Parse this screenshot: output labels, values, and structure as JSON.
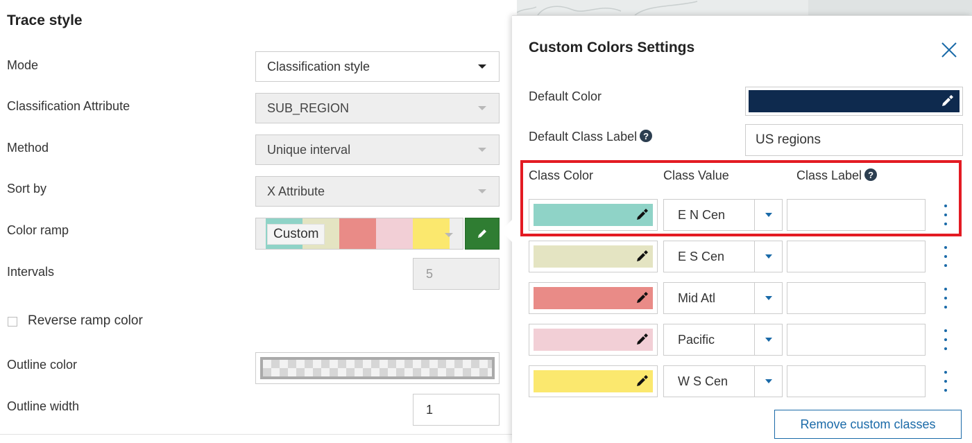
{
  "left_panel": {
    "title": "Trace style",
    "mode": {
      "label": "Mode",
      "value": "Classification style"
    },
    "classification_attribute": {
      "label": "Classification Attribute",
      "value": "SUB_REGION"
    },
    "method": {
      "label": "Method",
      "value": "Unique interval"
    },
    "sort_by": {
      "label": "Sort by",
      "value": "X Attribute"
    },
    "color_ramp": {
      "label": "Color ramp",
      "value": "Custom",
      "colors": [
        "#8fd3c7",
        "#e4e4c2",
        "#e98b87",
        "#f2cfd6",
        "#fbe86e"
      ],
      "edit_icon": "pencil-icon"
    },
    "intervals": {
      "label": "Intervals",
      "value": "5"
    },
    "reverse_ramp": {
      "label": "Reverse ramp color",
      "checked": false
    },
    "outline_color": {
      "label": "Outline color"
    },
    "outline_width": {
      "label": "Outline width",
      "value": "1"
    }
  },
  "dialog": {
    "title": "Custom Colors Settings",
    "close_icon": "close-icon",
    "default_color": {
      "label": "Default Color",
      "color": "#0e2a4e"
    },
    "default_class_label": {
      "label": "Default Class Label",
      "value": "US regions",
      "help_icon": "question-circle-icon"
    },
    "columns": {
      "class_color": "Class Color",
      "class_value": "Class Value",
      "class_label": "Class Label"
    },
    "rows": [
      {
        "color": "#8fd3c7",
        "value": "E N Cen",
        "label": ""
      },
      {
        "color": "#e4e4c2",
        "value": "E S Cen",
        "label": ""
      },
      {
        "color": "#e98b87",
        "value": "Mid Atl",
        "label": ""
      },
      {
        "color": "#f2cfd6",
        "value": "Pacific",
        "label": ""
      },
      {
        "color": "#fbe86e",
        "value": "W S Cen",
        "label": ""
      }
    ],
    "remove_button": "Remove custom classes",
    "highlight_color": "#e31b23"
  }
}
